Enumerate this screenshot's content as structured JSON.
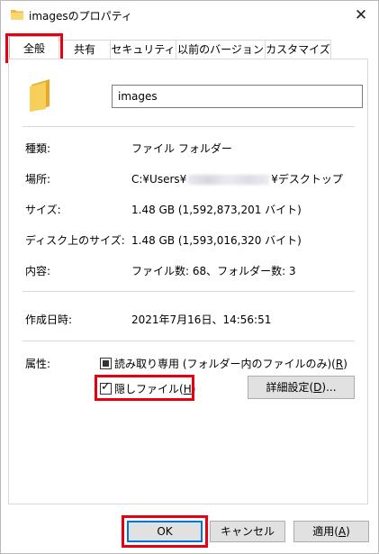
{
  "window": {
    "title": "imagesのプロパティ",
    "close_glyph": "✕"
  },
  "tabs": [
    {
      "label": "全般",
      "active": true
    },
    {
      "label": "共有"
    },
    {
      "label": "セキュリティ"
    },
    {
      "label": "以前のバージョン"
    },
    {
      "label": "カスタマイズ"
    }
  ],
  "general": {
    "name_value": "images",
    "type_label": "種類:",
    "type_value": "ファイル フォルダー",
    "location_label": "場所:",
    "location_prefix": "C:¥Users¥",
    "location_suffix": "¥デスクトップ",
    "size_label": "サイズ:",
    "size_value": "1.48 GB (1,592,873,201 バイト)",
    "disk_size_label": "ディスク上のサイズ:",
    "disk_size_value": "1.48 GB (1,593,016,320 バイト)",
    "contents_label": "内容:",
    "contents_value": "ファイル数: 68、フォルダー数: 3",
    "created_label": "作成日時:",
    "created_value": "2021年7月16日、14:56:51",
    "attributes_label": "属性:",
    "readonly_label": "読み取り専用 (フォルダー内のファイルのみ)(",
    "readonly_key": "R",
    "readonly_end": ")",
    "readonly_state": "indeterminate",
    "hidden_label": "隠しファイル(",
    "hidden_key": "H",
    "hidden_end": ")",
    "hidden_checked": true,
    "advanced_label": "詳細設定(",
    "advanced_key": "D",
    "advanced_end": ")..."
  },
  "buttons": {
    "ok": "OK",
    "cancel": "キャンセル",
    "apply_label": "適用(",
    "apply_key": "A",
    "apply_end": ")"
  },
  "colors": {
    "highlight": "#e60012",
    "folder": "#f5c842",
    "default_button_border": "#0078d7"
  }
}
